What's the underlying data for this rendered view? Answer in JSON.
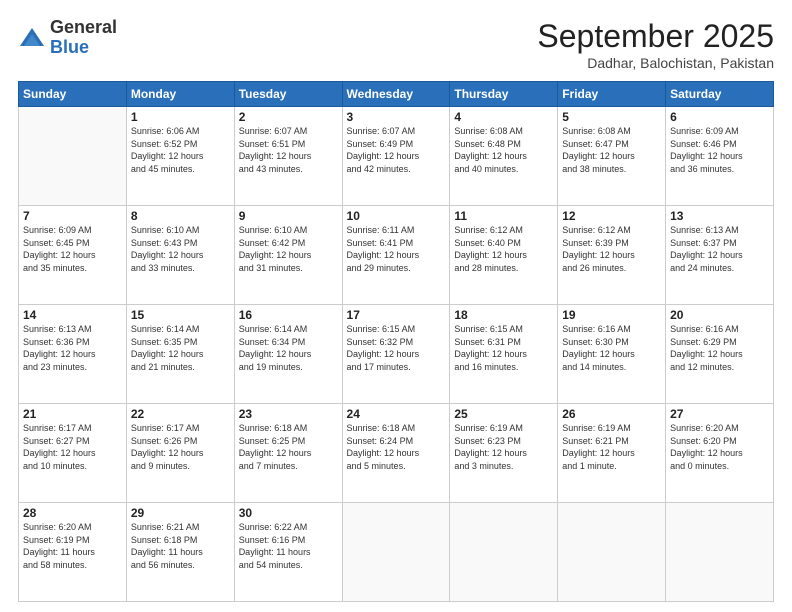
{
  "header": {
    "logo_general": "General",
    "logo_blue": "Blue",
    "main_title": "September 2025",
    "sub_title": "Dadhar, Balochistan, Pakistan"
  },
  "days_of_week": [
    "Sunday",
    "Monday",
    "Tuesday",
    "Wednesday",
    "Thursday",
    "Friday",
    "Saturday"
  ],
  "weeks": [
    [
      {
        "day": "",
        "info": ""
      },
      {
        "day": "1",
        "info": "Sunrise: 6:06 AM\nSunset: 6:52 PM\nDaylight: 12 hours\nand 45 minutes."
      },
      {
        "day": "2",
        "info": "Sunrise: 6:07 AM\nSunset: 6:51 PM\nDaylight: 12 hours\nand 43 minutes."
      },
      {
        "day": "3",
        "info": "Sunrise: 6:07 AM\nSunset: 6:49 PM\nDaylight: 12 hours\nand 42 minutes."
      },
      {
        "day": "4",
        "info": "Sunrise: 6:08 AM\nSunset: 6:48 PM\nDaylight: 12 hours\nand 40 minutes."
      },
      {
        "day": "5",
        "info": "Sunrise: 6:08 AM\nSunset: 6:47 PM\nDaylight: 12 hours\nand 38 minutes."
      },
      {
        "day": "6",
        "info": "Sunrise: 6:09 AM\nSunset: 6:46 PM\nDaylight: 12 hours\nand 36 minutes."
      }
    ],
    [
      {
        "day": "7",
        "info": "Sunrise: 6:09 AM\nSunset: 6:45 PM\nDaylight: 12 hours\nand 35 minutes."
      },
      {
        "day": "8",
        "info": "Sunrise: 6:10 AM\nSunset: 6:43 PM\nDaylight: 12 hours\nand 33 minutes."
      },
      {
        "day": "9",
        "info": "Sunrise: 6:10 AM\nSunset: 6:42 PM\nDaylight: 12 hours\nand 31 minutes."
      },
      {
        "day": "10",
        "info": "Sunrise: 6:11 AM\nSunset: 6:41 PM\nDaylight: 12 hours\nand 29 minutes."
      },
      {
        "day": "11",
        "info": "Sunrise: 6:12 AM\nSunset: 6:40 PM\nDaylight: 12 hours\nand 28 minutes."
      },
      {
        "day": "12",
        "info": "Sunrise: 6:12 AM\nSunset: 6:39 PM\nDaylight: 12 hours\nand 26 minutes."
      },
      {
        "day": "13",
        "info": "Sunrise: 6:13 AM\nSunset: 6:37 PM\nDaylight: 12 hours\nand 24 minutes."
      }
    ],
    [
      {
        "day": "14",
        "info": "Sunrise: 6:13 AM\nSunset: 6:36 PM\nDaylight: 12 hours\nand 23 minutes."
      },
      {
        "day": "15",
        "info": "Sunrise: 6:14 AM\nSunset: 6:35 PM\nDaylight: 12 hours\nand 21 minutes."
      },
      {
        "day": "16",
        "info": "Sunrise: 6:14 AM\nSunset: 6:34 PM\nDaylight: 12 hours\nand 19 minutes."
      },
      {
        "day": "17",
        "info": "Sunrise: 6:15 AM\nSunset: 6:32 PM\nDaylight: 12 hours\nand 17 minutes."
      },
      {
        "day": "18",
        "info": "Sunrise: 6:15 AM\nSunset: 6:31 PM\nDaylight: 12 hours\nand 16 minutes."
      },
      {
        "day": "19",
        "info": "Sunrise: 6:16 AM\nSunset: 6:30 PM\nDaylight: 12 hours\nand 14 minutes."
      },
      {
        "day": "20",
        "info": "Sunrise: 6:16 AM\nSunset: 6:29 PM\nDaylight: 12 hours\nand 12 minutes."
      }
    ],
    [
      {
        "day": "21",
        "info": "Sunrise: 6:17 AM\nSunset: 6:27 PM\nDaylight: 12 hours\nand 10 minutes."
      },
      {
        "day": "22",
        "info": "Sunrise: 6:17 AM\nSunset: 6:26 PM\nDaylight: 12 hours\nand 9 minutes."
      },
      {
        "day": "23",
        "info": "Sunrise: 6:18 AM\nSunset: 6:25 PM\nDaylight: 12 hours\nand 7 minutes."
      },
      {
        "day": "24",
        "info": "Sunrise: 6:18 AM\nSunset: 6:24 PM\nDaylight: 12 hours\nand 5 minutes."
      },
      {
        "day": "25",
        "info": "Sunrise: 6:19 AM\nSunset: 6:23 PM\nDaylight: 12 hours\nand 3 minutes."
      },
      {
        "day": "26",
        "info": "Sunrise: 6:19 AM\nSunset: 6:21 PM\nDaylight: 12 hours\nand 1 minute."
      },
      {
        "day": "27",
        "info": "Sunrise: 6:20 AM\nSunset: 6:20 PM\nDaylight: 12 hours\nand 0 minutes."
      }
    ],
    [
      {
        "day": "28",
        "info": "Sunrise: 6:20 AM\nSunset: 6:19 PM\nDaylight: 11 hours\nand 58 minutes."
      },
      {
        "day": "29",
        "info": "Sunrise: 6:21 AM\nSunset: 6:18 PM\nDaylight: 11 hours\nand 56 minutes."
      },
      {
        "day": "30",
        "info": "Sunrise: 6:22 AM\nSunset: 6:16 PM\nDaylight: 11 hours\nand 54 minutes."
      },
      {
        "day": "",
        "info": ""
      },
      {
        "day": "",
        "info": ""
      },
      {
        "day": "",
        "info": ""
      },
      {
        "day": "",
        "info": ""
      }
    ]
  ]
}
